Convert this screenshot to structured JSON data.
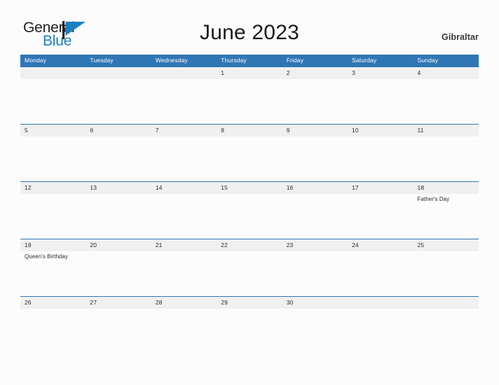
{
  "brand": {
    "name_part1": "General",
    "name_part2": "Blue",
    "flag_icon": "blue-flag-triangle-icon",
    "color_primary": "#1b7fc4",
    "color_text": "#221f20"
  },
  "header": {
    "title": "June 2023",
    "region": "Gibraltar",
    "header_bg": "#2f76b5",
    "band_bg": "#f0f0f0"
  },
  "calendar": {
    "month": "June",
    "year": "2023",
    "day_names": [
      "Monday",
      "Tuesday",
      "Wednesday",
      "Thursday",
      "Friday",
      "Saturday",
      "Sunday"
    ],
    "weeks": [
      [
        {
          "date": "",
          "event": ""
        },
        {
          "date": "",
          "event": ""
        },
        {
          "date": "",
          "event": ""
        },
        {
          "date": "1",
          "event": ""
        },
        {
          "date": "2",
          "event": ""
        },
        {
          "date": "3",
          "event": ""
        },
        {
          "date": "4",
          "event": ""
        }
      ],
      [
        {
          "date": "5",
          "event": ""
        },
        {
          "date": "6",
          "event": ""
        },
        {
          "date": "7",
          "event": ""
        },
        {
          "date": "8",
          "event": ""
        },
        {
          "date": "9",
          "event": ""
        },
        {
          "date": "10",
          "event": ""
        },
        {
          "date": "11",
          "event": ""
        }
      ],
      [
        {
          "date": "12",
          "event": ""
        },
        {
          "date": "13",
          "event": ""
        },
        {
          "date": "14",
          "event": ""
        },
        {
          "date": "15",
          "event": ""
        },
        {
          "date": "16",
          "event": ""
        },
        {
          "date": "17",
          "event": ""
        },
        {
          "date": "18",
          "event": "Father's Day"
        }
      ],
      [
        {
          "date": "19",
          "event": "Queen's Birthday"
        },
        {
          "date": "20",
          "event": ""
        },
        {
          "date": "21",
          "event": ""
        },
        {
          "date": "22",
          "event": ""
        },
        {
          "date": "23",
          "event": ""
        },
        {
          "date": "24",
          "event": ""
        },
        {
          "date": "25",
          "event": ""
        }
      ],
      [
        {
          "date": "26",
          "event": ""
        },
        {
          "date": "27",
          "event": ""
        },
        {
          "date": "28",
          "event": ""
        },
        {
          "date": "29",
          "event": ""
        },
        {
          "date": "30",
          "event": ""
        },
        {
          "date": "",
          "event": ""
        },
        {
          "date": "",
          "event": ""
        }
      ]
    ]
  }
}
